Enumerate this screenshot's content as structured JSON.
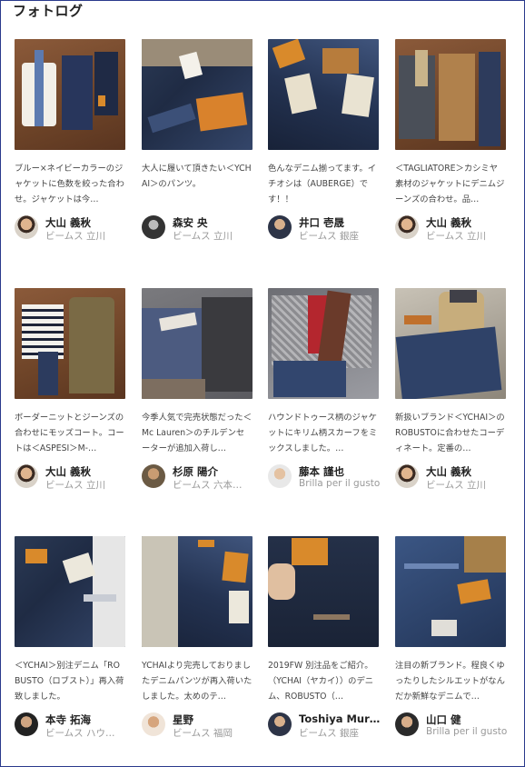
{
  "page": {
    "title": "フォトログ"
  },
  "cards": [
    {
      "caption": "ブルー×ネイビーカラーのジャケットに色数を絞った合わせ。ジャケットは今…",
      "author": "大山 義秋",
      "shop": "ビームス 立川"
    },
    {
      "caption": "大人に履いて頂きたい＜YCHAI＞のパンツ。",
      "author": "森安 央",
      "shop": "ビームス 立川"
    },
    {
      "caption": "色んなデニム揃ってます。イチオシは（AUBERGE）です！！",
      "author": "井口 壱晟",
      "shop": "ビームス 銀座"
    },
    {
      "caption": "＜TAGLIATORE＞カシミヤ素材のジャケットにデニムジーンズの合わせ。品…",
      "author": "大山 義秋",
      "shop": "ビームス 立川"
    },
    {
      "caption": "ボーダーニットとジーンズの合わせにモッズコート。コートは＜ASPESI＞M-…",
      "author": "大山 義秋",
      "shop": "ビームス 立川"
    },
    {
      "caption": "今季人気で完売状態だった＜Mc Lauren＞のチルデンセーターが追加入荷し…",
      "author": "杉原 陽介",
      "shop": "ビームス 六本…"
    },
    {
      "caption": "ハウンドトゥース柄のジャケットにキリム柄スカーフをミックスしました。…",
      "author": "藤本 謹也",
      "shop": "Brilla per il gusto"
    },
    {
      "caption": "新扱いブランド＜YCHAI＞のROBUSTOに合わせたコーディネート。定番の…",
      "author": "大山 義秋",
      "shop": "ビームス 立川"
    },
    {
      "caption": "＜YCHAI＞別注デニム「ROBUSTO（ロブスト）」再入荷致しました。",
      "author": "本寺 拓海",
      "shop": "ビームス ハウ…"
    },
    {
      "caption": "YCHAIより完売しておりましたデニムパンツが再入荷いたしました。太めのテ…",
      "author": "星野",
      "shop": "ビームス 福岡"
    },
    {
      "caption": "2019FW 別注品をご紹介。（YCHAI（ヤカイ））のデニム、ROBUSTO（…",
      "author": "Toshiya Mur…",
      "shop": "ビームス 銀座"
    },
    {
      "caption": "注目の新ブランド。程良くゆったりしたシルエットがなんだか新鮮なデニムで…",
      "author": "山口 健",
      "shop": "Brilla per il gusto"
    }
  ]
}
